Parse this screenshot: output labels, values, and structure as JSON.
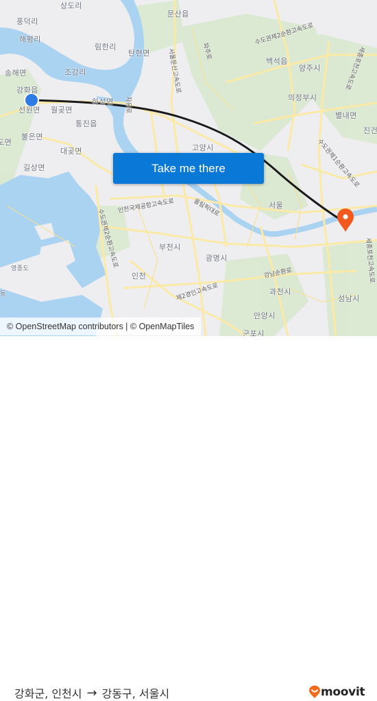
{
  "map": {
    "place_labels": [
      {
        "name": "상도리"
      },
      {
        "name": "풍덕리"
      },
      {
        "name": "해평리"
      },
      {
        "name": "문산읍"
      },
      {
        "name": "림한리"
      },
      {
        "name": "탄현면"
      },
      {
        "name": "송해면"
      },
      {
        "name": "조강리"
      },
      {
        "name": "강화읍"
      },
      {
        "name": "하성면"
      },
      {
        "name": "선원면"
      },
      {
        "name": "월곶면"
      },
      {
        "name": "통진읍"
      },
      {
        "name": "불은면"
      },
      {
        "name": "도면"
      },
      {
        "name": "대곶면"
      },
      {
        "name": "길상면"
      },
      {
        "name": "백석읍"
      },
      {
        "name": "양주시"
      },
      {
        "name": "의정부시"
      },
      {
        "name": "별내면"
      },
      {
        "name": "진건"
      },
      {
        "name": "고양시"
      },
      {
        "name": "서울"
      },
      {
        "name": "부천시"
      },
      {
        "name": "영종도"
      },
      {
        "name": "광명시"
      },
      {
        "name": "인천"
      },
      {
        "name": "과천시"
      },
      {
        "name": "안양시"
      },
      {
        "name": "성남시"
      },
      {
        "name": "군포시"
      },
      {
        "name": "동"
      }
    ],
    "road_labels": [
      {
        "name": "서울문산고속도로"
      },
      {
        "name": "파주로"
      },
      {
        "name": "수도권제2순환고속도로"
      },
      {
        "name": "세종포천고속도로"
      },
      {
        "name": "자유로"
      },
      {
        "name": "인천국제공항고속도로"
      },
      {
        "name": "올림픽대로"
      },
      {
        "name": "수도권제2순환고속도로"
      },
      {
        "name": "수도권제1순환고속도로"
      },
      {
        "name": "강남순환로"
      },
      {
        "name": "제2경인고속도로"
      },
      {
        "name": "세종포천고속도로"
      }
    ],
    "origin_marker": {
      "label": "강화군, 인천시",
      "color": "#2d7be5"
    },
    "destination_marker": {
      "label": "강동구, 서울시",
      "color": "#f2591f"
    },
    "route_color": "#1a1a1a",
    "water_color": "#aad3f2",
    "cta_button": {
      "label": "Take me there",
      "color": "#0a78d7"
    },
    "attribution": "© OpenStreetMap contributors | © OpenMapTiles"
  },
  "footer": {
    "origin": "강화군, 인천시",
    "arrow": "→",
    "destination": "강동구, 서울시",
    "logo_text": "moovit",
    "brand_color": "#f26b1d"
  }
}
